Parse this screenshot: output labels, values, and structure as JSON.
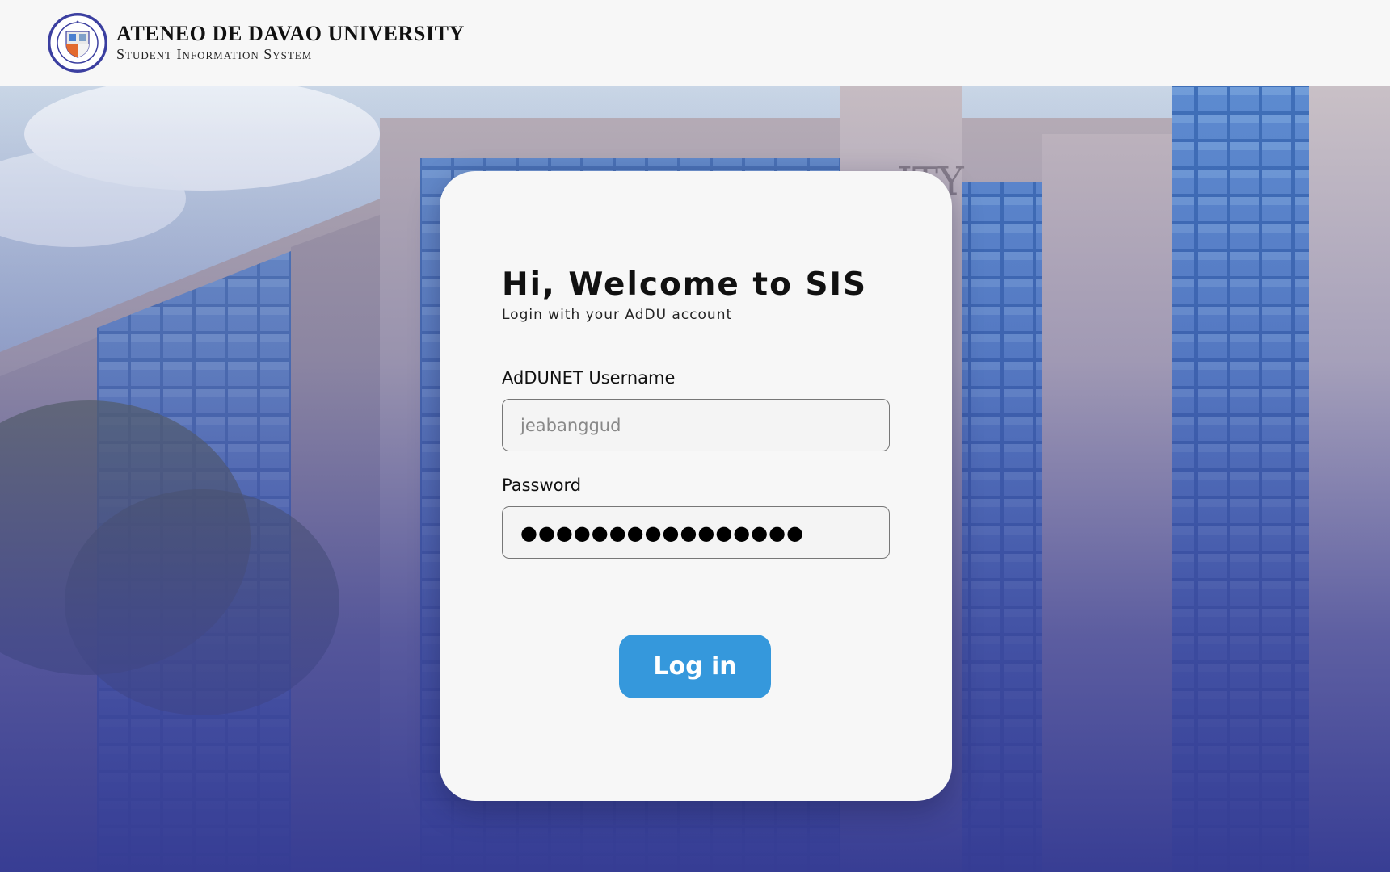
{
  "header": {
    "university_name": "ATENEO DE DAVAO UNIVERSITY",
    "system_name": "Student Information System",
    "seal_text": "FORTES IN FIDE · ATENEO DE DAVAO"
  },
  "login": {
    "title": "Hi, Welcome to SIS",
    "subtitle": "Login with your AdDU account",
    "username_label": "AdDUNET Username",
    "username_value": "jeabanggud",
    "password_label": "Password",
    "password_value": "●●●●●●●●●●●●●●●●",
    "login_button": "Log in"
  },
  "colors": {
    "accent": "#3598dc",
    "header_bg": "#f7f7f7",
    "overlay": "#3a3f96"
  }
}
